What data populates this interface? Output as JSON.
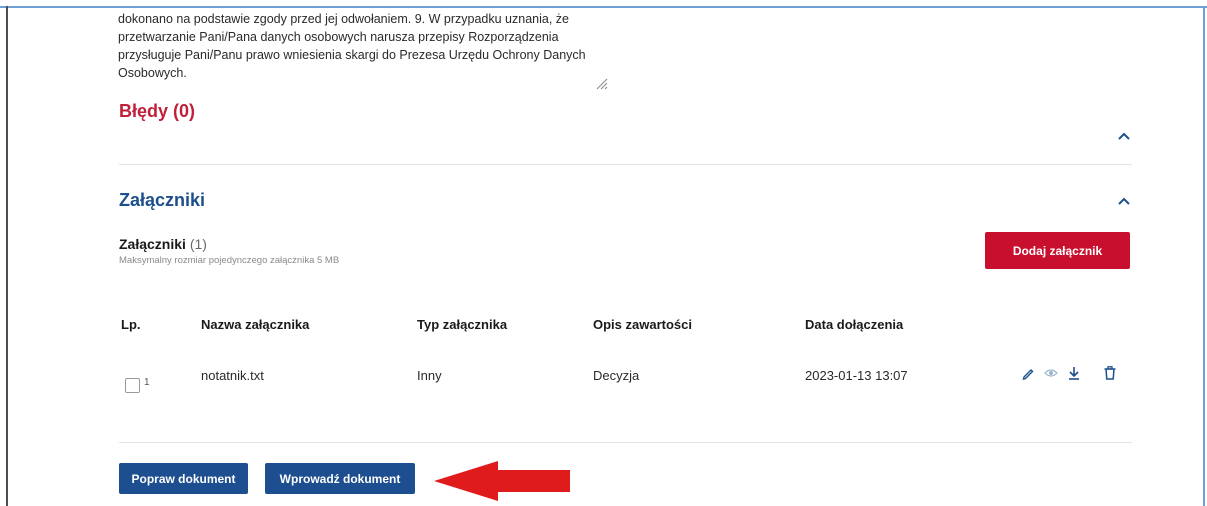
{
  "textarea": {
    "lines": [
      "dokonano na podstawie zgody przed jej odwołaniem. 9.  W przypadku uznania, że",
      "przetwarzanie Pani/Pana danych osobowych narusza przepisy Rozporządzenia",
      "przysługuje Pani/Panu prawo wniesienia skargi do Prezesa Urzędu Ochrony Danych",
      "Osobowych."
    ]
  },
  "errors_section": {
    "title": "Błędy (0)"
  },
  "attachments_section": {
    "title": "Załączniki",
    "heading": "Załączniki",
    "count": "(1)",
    "note": "Maksymalny rozmiar pojedynczego załącznika 5 MB",
    "add_button": "Dodaj załącznik"
  },
  "table": {
    "headers": [
      "Lp.",
      "Nazwa załącznika",
      "Typ załącznika",
      "Opis zawartości",
      "Data dołączenia"
    ],
    "rows": [
      {
        "lp": "1",
        "name": "notatnik.txt",
        "type": "Inny",
        "description": "Decyzja",
        "date": "2023-01-13 13:07"
      }
    ],
    "actions": [
      "pencil-icon",
      "eye-icon",
      "download-icon",
      "trash-icon"
    ]
  },
  "footer": {
    "fix_button": "Popraw dokument",
    "submit_button": "Wprowadź dokument"
  },
  "colors": {
    "accent_red": "#c8102e",
    "error_red": "#c21f3a",
    "primary_blue": "#1d4e8f",
    "title_blue": "#1c4f8c",
    "arrow_red": "#e01b1b"
  }
}
